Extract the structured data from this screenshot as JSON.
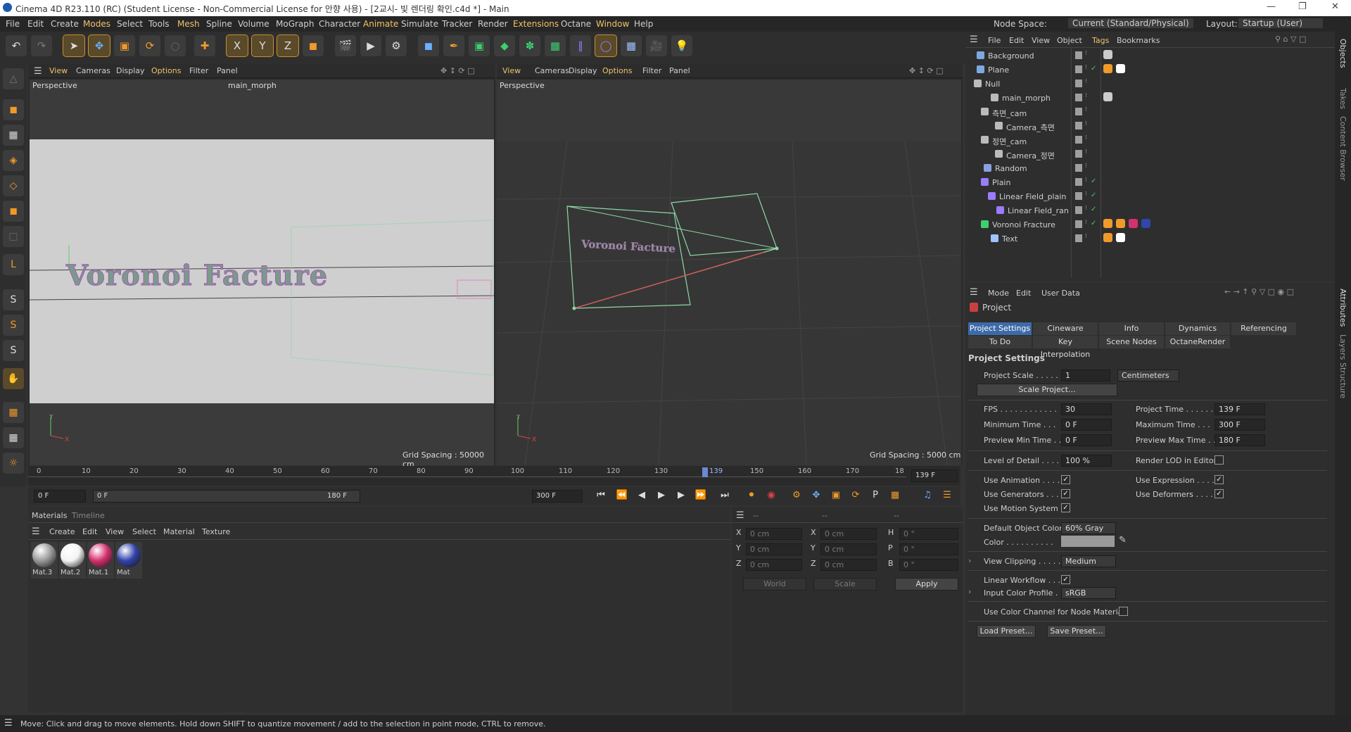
{
  "window": {
    "title": "Cinema 4D R23.110 (RC) (Student License - Non-Commercial License for 안향 사용) - [2교시- 빛 렌더링 확인.c4d *] - Main"
  },
  "menu": [
    "File",
    "Edit",
    "Create",
    "Modes",
    "Select",
    "Tools",
    "Mesh",
    "Spline",
    "Volume",
    "MoGraph",
    "Character",
    "Animate",
    "Simulate",
    "Tracker",
    "Render",
    "Extensions",
    "Octane",
    "Window",
    "Help"
  ],
  "nodespace": {
    "label": "Node Space:",
    "value": "Current (Standard/Physical)",
    "layout_label": "Layout:",
    "layout_value": "Startup (User)"
  },
  "viewport_left": {
    "menu": [
      "View",
      "Cameras",
      "Display",
      "Options",
      "Filter",
      "Panel"
    ],
    "name": "Perspective",
    "camera": "main_morph",
    "grid": "Grid Spacing : 50000 cm",
    "text3d": "Voronoi Facture"
  },
  "viewport_right": {
    "menu": [
      "View",
      "Cameras",
      "Display",
      "Options",
      "Filter",
      "Panel"
    ],
    "name": "Perspective",
    "grid": "Grid Spacing : 5000 cm",
    "text3d": "Voronoi Facture"
  },
  "timeline": {
    "ticks": [
      "0",
      "10",
      "20",
      "30",
      "40",
      "50",
      "60",
      "70",
      "80",
      "90",
      "100",
      "110",
      "120",
      "130",
      "139",
      "150",
      "160",
      "170",
      "18"
    ],
    "current": "139 F"
  },
  "playbar": {
    "start": "0 F",
    "range_start": "0 F",
    "range_end": "180 F",
    "end": "300 F"
  },
  "materials": {
    "tabs": [
      "Materials",
      "Timeline"
    ],
    "menu": [
      "Create",
      "Edit",
      "View",
      "Select",
      "Material",
      "Texture"
    ],
    "items": [
      "Mat.3",
      "Mat.2",
      "Mat.1",
      "Mat"
    ],
    "colors": [
      "#9a9a9a",
      "#f4f4f4",
      "#d4326e",
      "#3344aa"
    ]
  },
  "coords": {
    "headers": [
      "--",
      "--",
      "--"
    ],
    "rows": [
      {
        "a": "X",
        "av": "0 cm",
        "b": "X",
        "bv": "0 cm",
        "c": "H",
        "cv": "0 °"
      },
      {
        "a": "Y",
        "av": "0 cm",
        "b": "Y",
        "bv": "0 cm",
        "c": "P",
        "cv": "0 °"
      },
      {
        "a": "Z",
        "av": "0 cm",
        "b": "Z",
        "bv": "0 cm",
        "c": "B",
        "cv": "0 °"
      }
    ],
    "world": "World",
    "scale": "Scale",
    "apply": "Apply"
  },
  "objmgr": {
    "menu": [
      "File",
      "Edit",
      "View",
      "Object",
      "Tags",
      "Bookmarks"
    ],
    "objects": [
      "Background",
      "Plane",
      "Null",
      "main_morph",
      "측면_cam",
      "Camera_측면",
      "정면_cam",
      "Camera_정면",
      "Random",
      "Plain",
      "Linear Field_plain",
      "Linear Field_ran",
      "Voronoi Fracture",
      "Text"
    ]
  },
  "attr": {
    "menu": [
      "Mode",
      "Edit",
      "User Data"
    ],
    "object": "Project",
    "tabs_row1": [
      "Project Settings",
      "Cineware",
      "Info",
      "Dynamics",
      "Referencing"
    ],
    "tabs_row2": [
      "To Do",
      "Key Interpolation",
      "Scene Nodes",
      "OctaneRender"
    ],
    "section": "Project Settings",
    "project_scale_label": "Project Scale . . . . .",
    "project_scale": "1",
    "unit": "Centimeters",
    "scale_btn": "Scale Project...",
    "fps_label": "FPS . . . . . . . . . . . .",
    "fps": "30",
    "ptime_label": "Project Time . . . . . .",
    "ptime": "139 F",
    "mintime_label": "Minimum Time . . .",
    "mintime": "0 F",
    "maxtime_label": "Maximum Time . . .",
    "maxtime": "300 F",
    "pmin_label": "Preview Min Time . .",
    "pmin": "0 F",
    "pmax_label": "Preview Max Time . .",
    "pmax": "180 F",
    "lod_label": "Level of Detail . . . .",
    "lod": "100 %",
    "renderlod_label": "Render LOD in Editor",
    "useanim": "Use Animation . . . .",
    "usegen": "Use Generators . . .",
    "usemotion": "Use Motion System",
    "useexpr": "Use Expression . . . .",
    "usedef": "Use Deformers . . . .",
    "defcolor_label": "Default Object Color",
    "defcolor": "60% Gray",
    "color_label": "Color . . . . . . . . . .",
    "clip_label": "View Clipping . . . . .",
    "clip": "Medium",
    "linwf_label": "Linear Workflow . . .",
    "icp_label": "Input Color Profile . .",
    "icp": "sRGB",
    "usecc_label": "Use Color Channel for Node Material",
    "load": "Load Preset...",
    "save": "Save Preset..."
  },
  "rightstrip": [
    "Objects",
    "Takes",
    "Content Browser",
    "Attributes",
    "Layers",
    "Structure"
  ],
  "status": "Move: Click and drag to move elements. Hold down SHIFT to quantize movement / add to the selection in point mode, CTRL to remove."
}
